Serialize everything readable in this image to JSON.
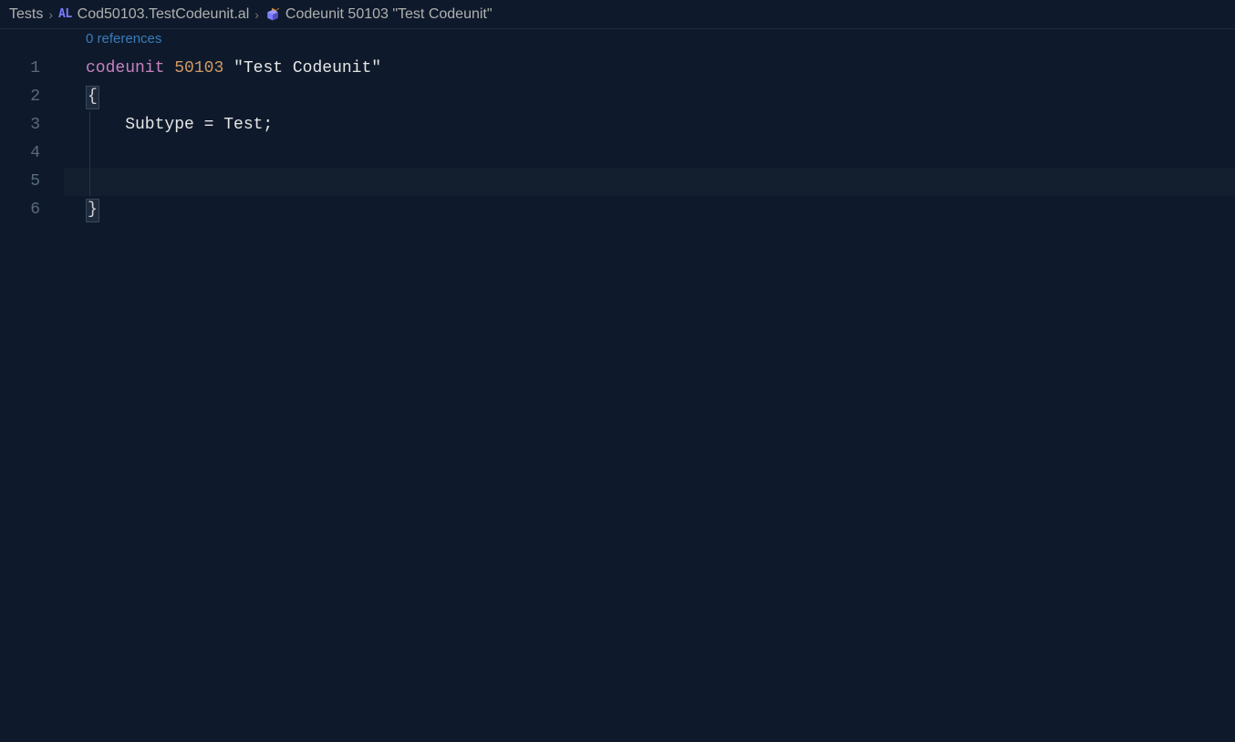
{
  "breadcrumb": {
    "folder": "Tests",
    "al_badge": "AL",
    "file": "Cod50103.TestCodeunit.al",
    "symbol": "Codeunit 50103 \"Test Codeunit\""
  },
  "codelens": {
    "references": "0 references"
  },
  "gutter": {
    "lines": [
      "1",
      "2",
      "3",
      "4",
      "5",
      "6"
    ]
  },
  "code": {
    "line1": {
      "keyword": "codeunit",
      "number": "50103",
      "string": "\"Test Codeunit\""
    },
    "line2": {
      "brace": "{"
    },
    "line3": {
      "text": "    Subtype = Test;"
    },
    "line4": {
      "text": ""
    },
    "line5": {
      "text": ""
    },
    "line6": {
      "brace": "}"
    }
  }
}
